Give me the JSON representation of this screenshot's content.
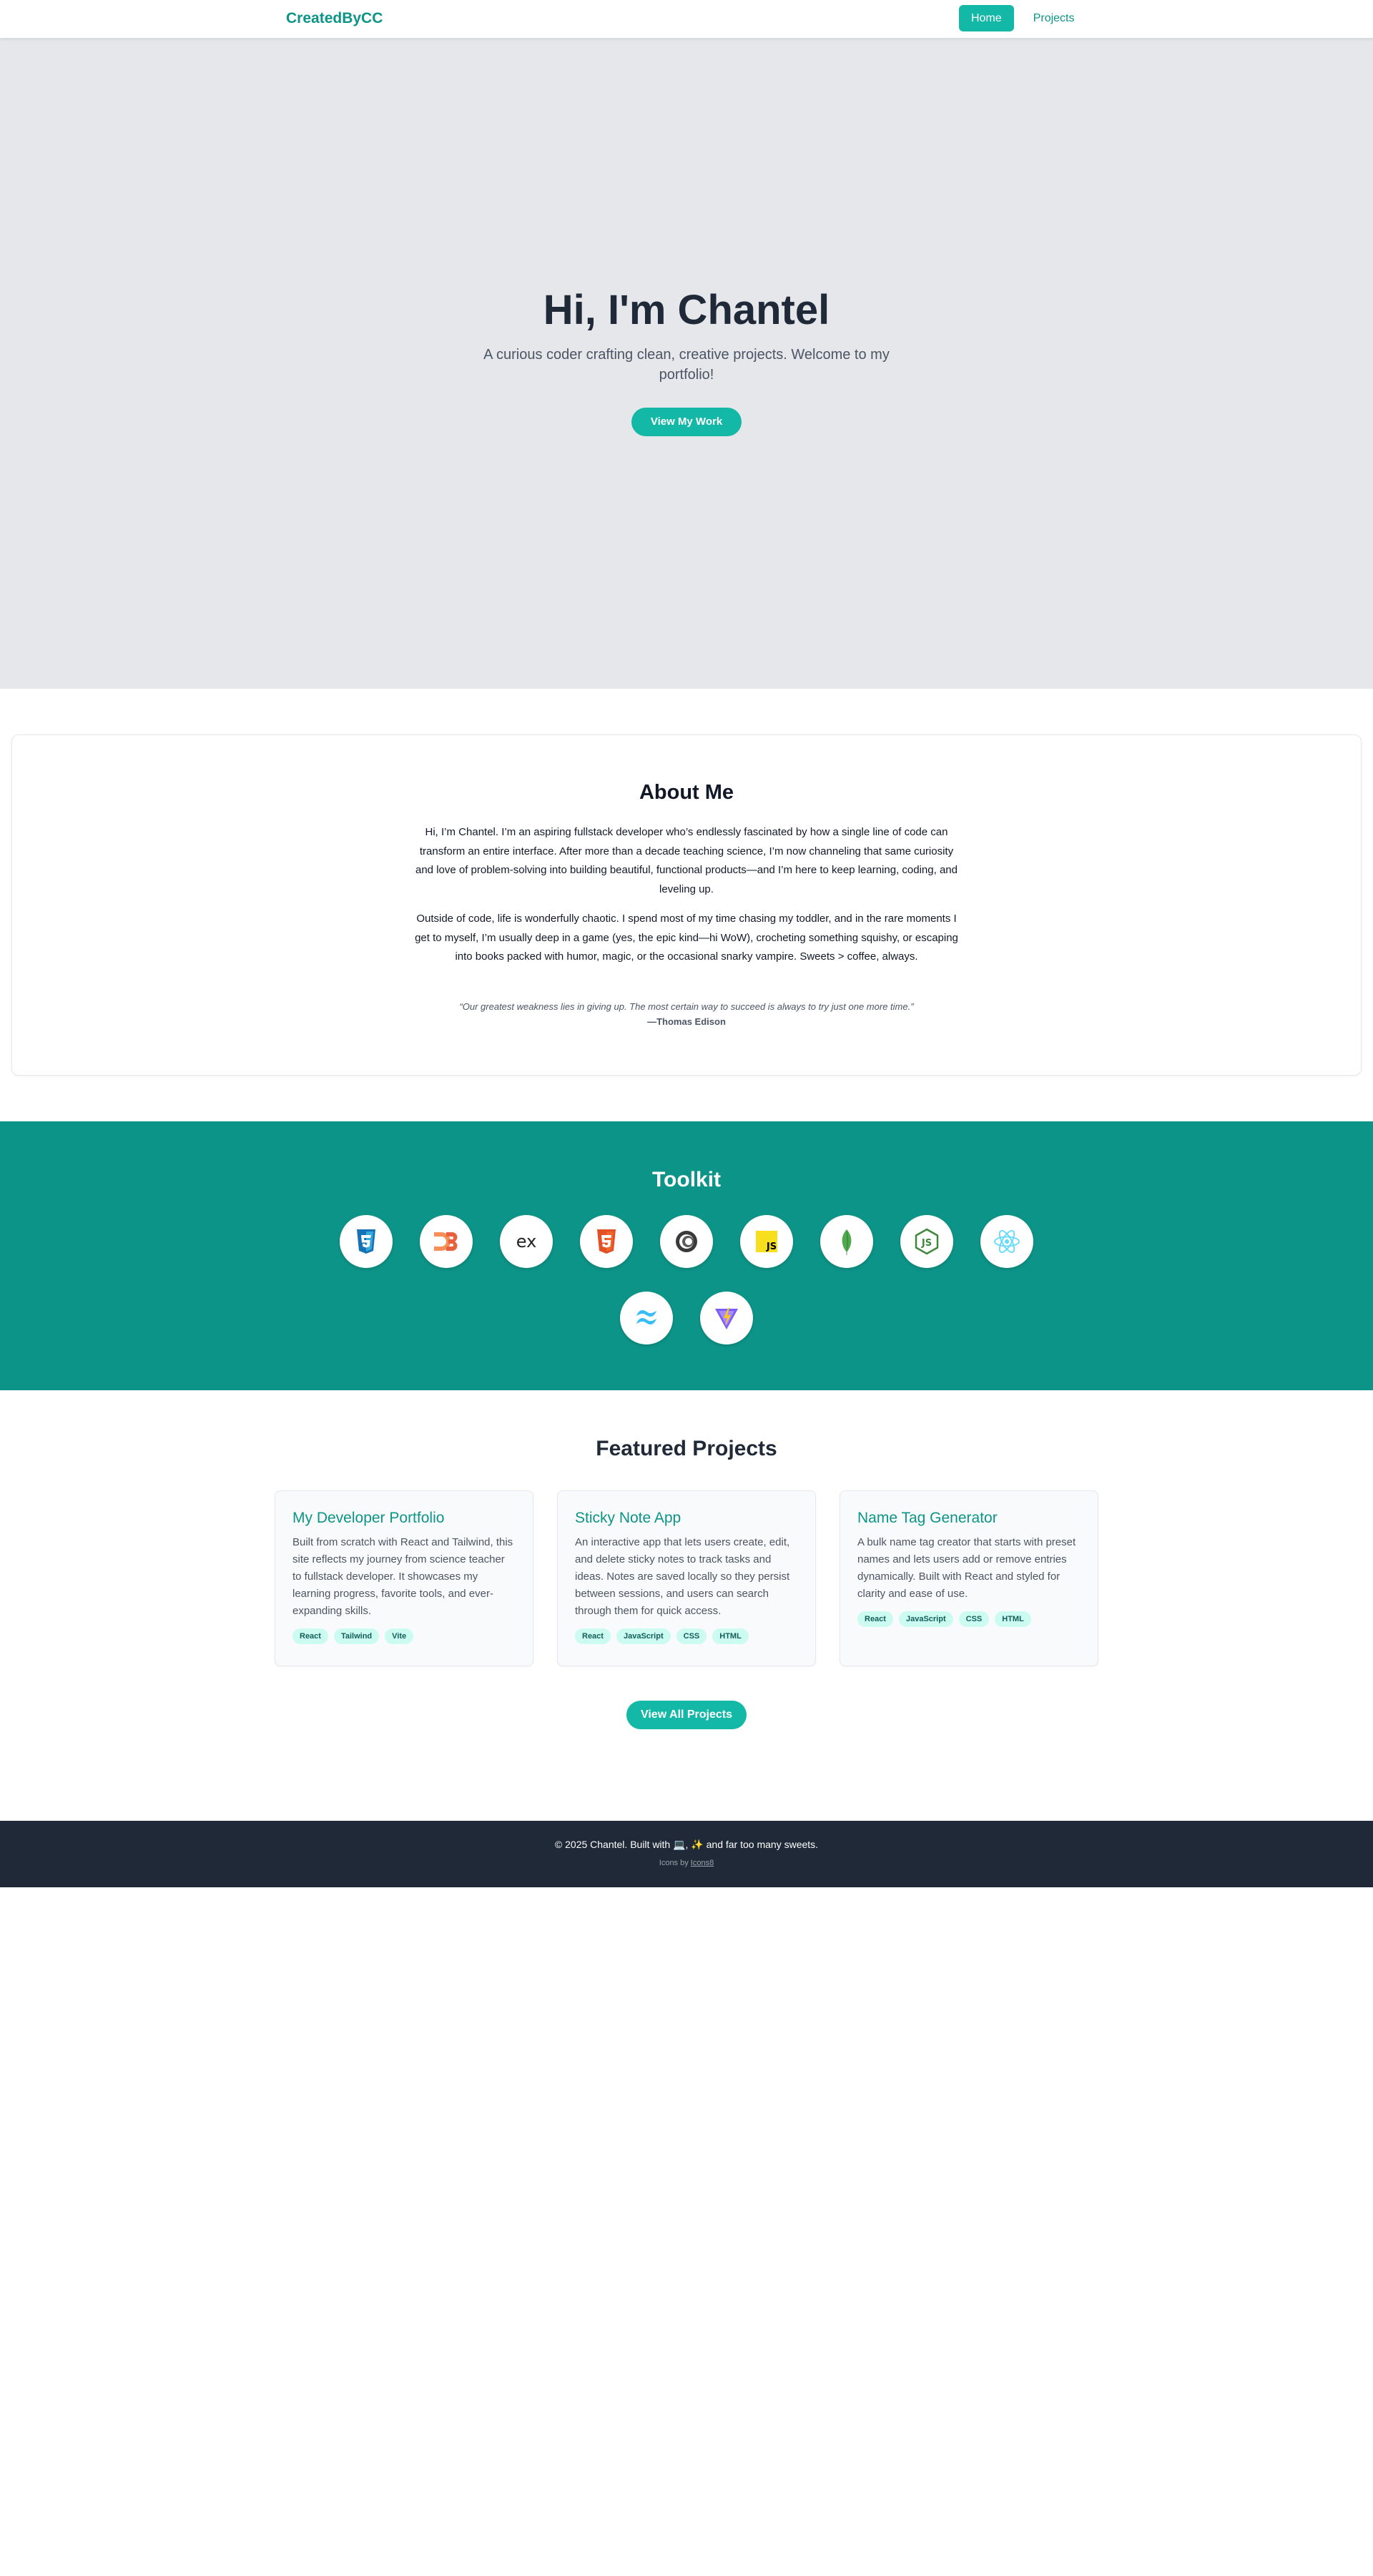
{
  "nav": {
    "brand": "CreatedByCC",
    "links": [
      {
        "label": "Home",
        "active": true
      },
      {
        "label": "Projects",
        "active": false
      }
    ]
  },
  "hero": {
    "title": "Hi, I'm Chantel",
    "subtitle": "A curious coder crafting clean, creative projects. Welcome to my portfolio!",
    "cta": "View My Work"
  },
  "about": {
    "title": "About Me",
    "paragraphs": [
      "Hi, I’m Chantel. I’m an aspiring fullstack developer who’s endlessly fascinated by how a single line of code can transform an entire interface. After more than a decade teaching science, I’m now channeling that same curiosity and love of problem-solving into building beautiful, functional products—and I’m here to keep learning, coding, and leveling up.",
      "Outside of code, life is wonderfully chaotic. I spend most of my time chasing my toddler, and in the rare moments I get to myself, I’m usually deep in a game (yes, the epic kind—hi WoW), crocheting something squishy, or escaping into books packed with humor, magic, or the occasional snarky vampire. Sweets > coffee, always."
    ],
    "quote": "“Our greatest weakness lies in giving up. The most certain way to succeed is always to try just one more time.”",
    "quote_author": "—Thomas Edison"
  },
  "toolkit": {
    "title": "Toolkit",
    "tools": [
      {
        "icon": "css3-icon"
      },
      {
        "icon": "d3-icon"
      },
      {
        "icon": "express-icon"
      },
      {
        "icon": "html5-icon"
      },
      {
        "icon": "jest-icon"
      },
      {
        "icon": "javascript-icon"
      },
      {
        "icon": "mongodb-icon"
      },
      {
        "icon": "nodejs-icon"
      },
      {
        "icon": "react-icon"
      },
      {
        "icon": "tailwind-icon"
      },
      {
        "icon": "vite-icon"
      }
    ]
  },
  "projects": {
    "title": "Featured Projects",
    "cards": [
      {
        "title": "My Developer Portfolio",
        "description": "Built from scratch with React and Tailwind, this site reflects my journey from science teacher to fullstack developer. It showcases my learning progress, favorite tools, and ever-expanding skills.",
        "tags": [
          "React",
          "Tailwind",
          "Vite"
        ]
      },
      {
        "title": "Sticky Note App",
        "description": "An interactive app that lets users create, edit, and delete sticky notes to track tasks and ideas. Notes are saved locally so they persist between sessions, and users can search through them for quick access.",
        "tags": [
          "React",
          "JavaScript",
          "CSS",
          "HTML"
        ]
      },
      {
        "title": "Name Tag Generator",
        "description": "A bulk name tag creator that starts with preset names and lets users add or remove entries dynamically. Built with React and styled for clarity and ease of use.",
        "tags": [
          "React",
          "JavaScript",
          "CSS",
          "HTML"
        ]
      }
    ],
    "view_all": "View All Projects"
  },
  "footer": {
    "main": "© 2025 Chantel. Built with 💻, ✨ and far too many sweets.",
    "icons_prefix": "Icons by ",
    "icons_link": "Icons8"
  },
  "colors": {
    "teal_primary": "#0d9488",
    "teal_button": "#14b8a6",
    "hero_bg": "#e5e7eb",
    "footer_bg": "#1f2937"
  }
}
